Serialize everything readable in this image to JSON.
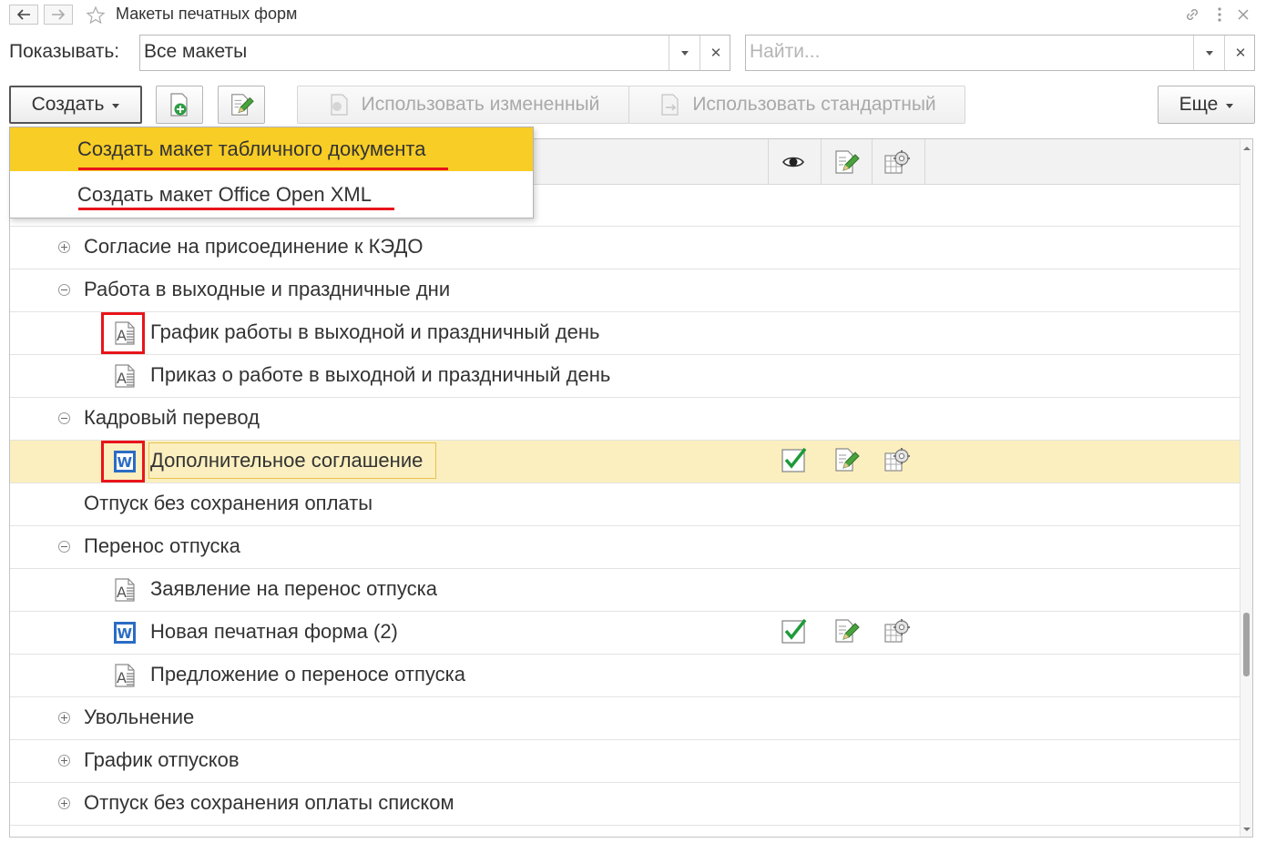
{
  "window": {
    "title": "Макеты печатных форм"
  },
  "filter": {
    "label": "Показывать:",
    "value": "Все макеты",
    "search_placeholder": "Найти..."
  },
  "toolbar": {
    "create_label": "Создать",
    "use_modified_label": "Использовать измененный",
    "use_standard_label": "Использовать стандартный",
    "more_label": "Еще"
  },
  "dropdown": {
    "items": [
      {
        "label": "Создать макет табличного документа"
      },
      {
        "label": "Создать макет Office Open XML"
      }
    ]
  },
  "rows": [
    {
      "label": ""
    },
    {
      "label": "Согласие на присоединение к КЭДО",
      "kind": "group-collapsed"
    },
    {
      "label": "Работа в выходные и праздничные дни",
      "kind": "group-expanded"
    },
    {
      "label": "График работы в выходной и праздничный день",
      "icon": "spreadsheet-template-icon"
    },
    {
      "label": "Приказ о работе в выходной и праздничный день",
      "icon": "spreadsheet-template-icon"
    },
    {
      "label": "Кадровый перевод",
      "kind": "group-expanded"
    },
    {
      "label": "Дополнительное соглашение",
      "icon": "word-template-icon",
      "used": true,
      "selected": true
    },
    {
      "label": "Отпуск без сохранения оплаты",
      "kind": "group-leaf"
    },
    {
      "label": "Перенос отпуска",
      "kind": "group-expanded"
    },
    {
      "label": "Заявление на перенос отпуска",
      "icon": "spreadsheet-template-icon"
    },
    {
      "label": "Новая печатная форма (2)",
      "icon": "word-template-icon",
      "used": true
    },
    {
      "label": "Предложение о переносе отпуска",
      "icon": "spreadsheet-template-icon"
    },
    {
      "label": "Увольнение",
      "kind": "group-collapsed"
    },
    {
      "label": "График отпусков",
      "kind": "group-collapsed"
    },
    {
      "label": "Отпуск без сохранения оплаты списком",
      "kind": "group-collapsed"
    }
  ],
  "colors": {
    "highlight": "#f8cd25",
    "selected_row": "#fbefbf",
    "annotation": "#e8141b",
    "check": "#1e9a3a",
    "word": "#2b6cc4"
  }
}
